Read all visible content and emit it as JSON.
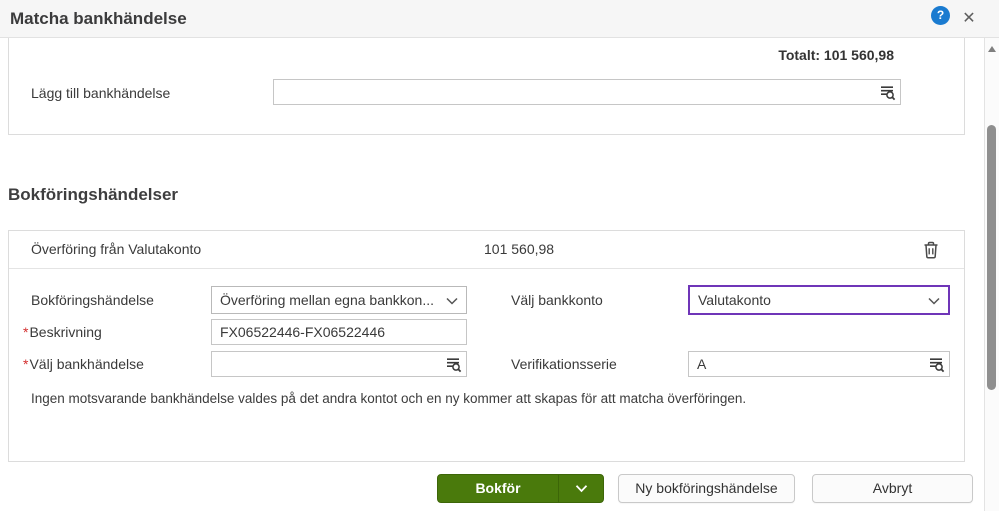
{
  "header": {
    "title": "Matcha bankhändelse",
    "help_glyph": "?",
    "close_glyph": "✕"
  },
  "bank_events_panel": {
    "total": "Totalt: 101 560,98",
    "add_label": "Lägg till bankhändelse",
    "add_value": ""
  },
  "section": {
    "heading": "Bokföringshändelser",
    "entry_title": "Överföring från Valutakonto",
    "entry_amount": "101 560,98"
  },
  "form": {
    "required_mark": "*",
    "event_type_label": "Bokföringshändelse",
    "event_type_value": "Överföring mellan egna bankkon...",
    "account_label": "Välj bankkonto",
    "account_value": "Valutakonto",
    "description_label": "Beskrivning",
    "description_value": "FX06522446-FX06522446",
    "bank_event_label": "Välj bankhändelse",
    "bank_event_value": "",
    "series_label": "Verifikationsserie",
    "series_value": "A",
    "info_text": "Ingen motsvarande bankhändelse valdes på det andra kontot och en ny kommer att skapas för att matcha överföringen."
  },
  "footer": {
    "post_button": "Bokför",
    "new_entry_button": "Ny bokföringshändelse",
    "cancel_button": "Avbryt"
  },
  "colors": {
    "accent_green": "#4a7a0c",
    "focus_purple": "#6f35b8",
    "help_blue": "#1a7bd0"
  }
}
